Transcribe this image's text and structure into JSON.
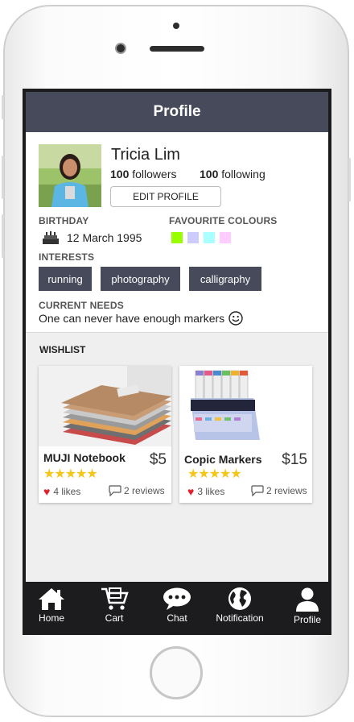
{
  "header": {
    "title": "Profile"
  },
  "profile": {
    "name": "Tricia Lim",
    "followers_count": "100",
    "followers_label": "followers",
    "following_count": "100",
    "following_label": "following",
    "edit_label": "EDIT PROFILE",
    "birthday_label": "BIRTHDAY",
    "birthday_value": "12 March 1995",
    "colours_label": "FAVOURITE COLOURS",
    "colours": [
      "#99ff00",
      "#ccccff",
      "#aaffff",
      "#ffccff"
    ],
    "interests_label": "INTERESTS",
    "interests": [
      "running",
      "photography",
      "calligraphy"
    ],
    "needs_label": "CURRENT NEEDS",
    "needs_value": "One can never have enough markers"
  },
  "wishlist": {
    "label": "WISHLIST",
    "items": [
      {
        "title": "MUJI Notebook",
        "price": "$5",
        "rating": 5,
        "likes": "4 likes",
        "reviews": "2 reviews"
      },
      {
        "title": "Copic Markers",
        "price": "$15",
        "rating": 5,
        "likes": "3 likes",
        "reviews": "2 reviews"
      }
    ]
  },
  "tabs": [
    {
      "label": "Home",
      "icon": "home-icon"
    },
    {
      "label": "Cart",
      "icon": "cart-icon"
    },
    {
      "label": "Chat",
      "icon": "chat-icon"
    },
    {
      "label": "Notification",
      "icon": "globe-icon"
    },
    {
      "label": "Profile",
      "icon": "person-icon"
    }
  ],
  "colors": {
    "header": "#474a5a",
    "tag": "#474a5a",
    "star": "#f5c518",
    "heart": "#e0202a",
    "tabbar": "#1c1c1e"
  }
}
